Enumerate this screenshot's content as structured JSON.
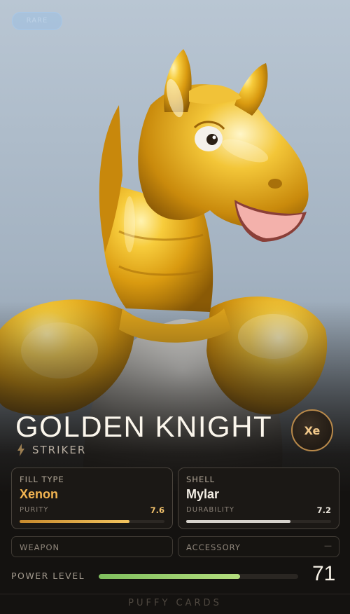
{
  "card": {
    "rarity_pill": "RARE",
    "title": "GOLDEN KNIGHT",
    "class_icon": "lightning-bolt-icon",
    "class_label": "STRIKER",
    "element_badge": "Xe",
    "hero_image": "inflatable-golden-horse-knight",
    "stats": {
      "fill_type": {
        "label": "FILL TYPE",
        "value": "Xenon",
        "stat_label": "PURITY",
        "stat_value": "7.6",
        "stat_fraction": 0.76
      },
      "shell": {
        "label": "SHELL",
        "value": "Mylar",
        "stat_label": "DURABILITY",
        "stat_value": "7.2",
        "stat_fraction": 0.72
      }
    },
    "slots": {
      "weapon": {
        "label": "WEAPON",
        "value": ""
      },
      "accessory": {
        "label": "ACCESSORY",
        "value": "—"
      }
    },
    "power": {
      "label": "POWER LEVEL",
      "value": "71",
      "fraction": 0.71
    },
    "footer": "PUFFY CARDS"
  },
  "colors": {
    "background": "#141210",
    "accent_gold": "#f2b451",
    "power_green": "#9fd070",
    "badge_ring": "#b8894a"
  }
}
